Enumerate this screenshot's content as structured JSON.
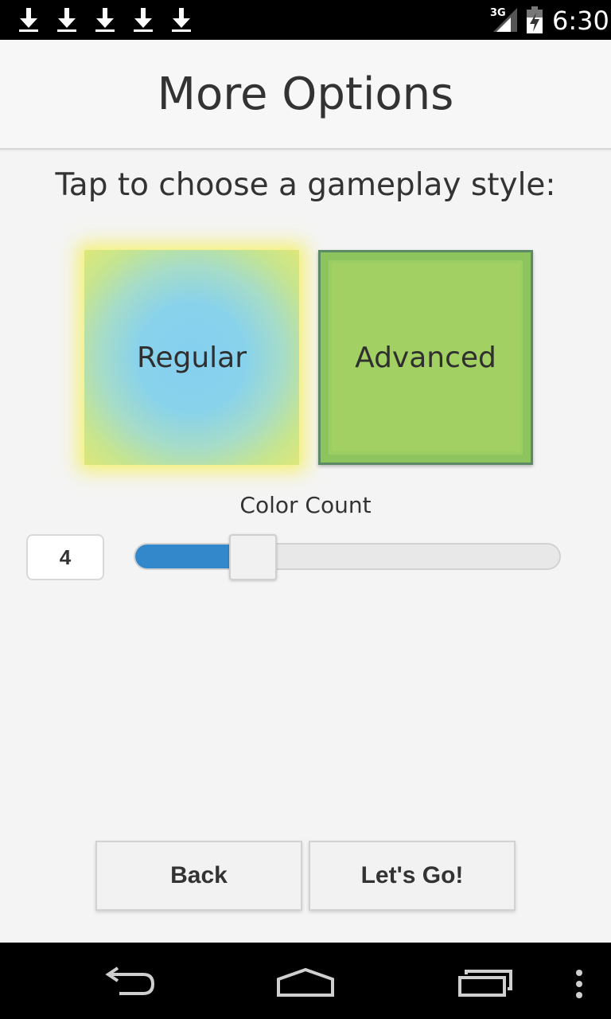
{
  "status_bar": {
    "network_label": "3G",
    "time": "6:30",
    "icons": [
      "download-icon",
      "download-icon",
      "download-icon",
      "download-icon",
      "download-icon",
      "signal-icon",
      "battery-icon"
    ]
  },
  "header": {
    "title": "More Options"
  },
  "main": {
    "instruction": "Tap to choose a gameplay style:",
    "styles": [
      {
        "label": "Regular",
        "selected": true
      },
      {
        "label": "Advanced",
        "selected": false
      }
    ],
    "color_count": {
      "label": "Color Count",
      "value": "4",
      "slider_fraction": 0.28
    }
  },
  "buttons": {
    "back_label": "Back",
    "go_label": "Let's Go!"
  },
  "nav_bar": {
    "icons": [
      "back-icon",
      "home-icon",
      "recent-apps-icon",
      "overflow-menu-icon"
    ]
  },
  "colors": {
    "accent": "#3388cc",
    "regular_glow": "#f5f05a",
    "advanced_tile": "#a2d062"
  }
}
